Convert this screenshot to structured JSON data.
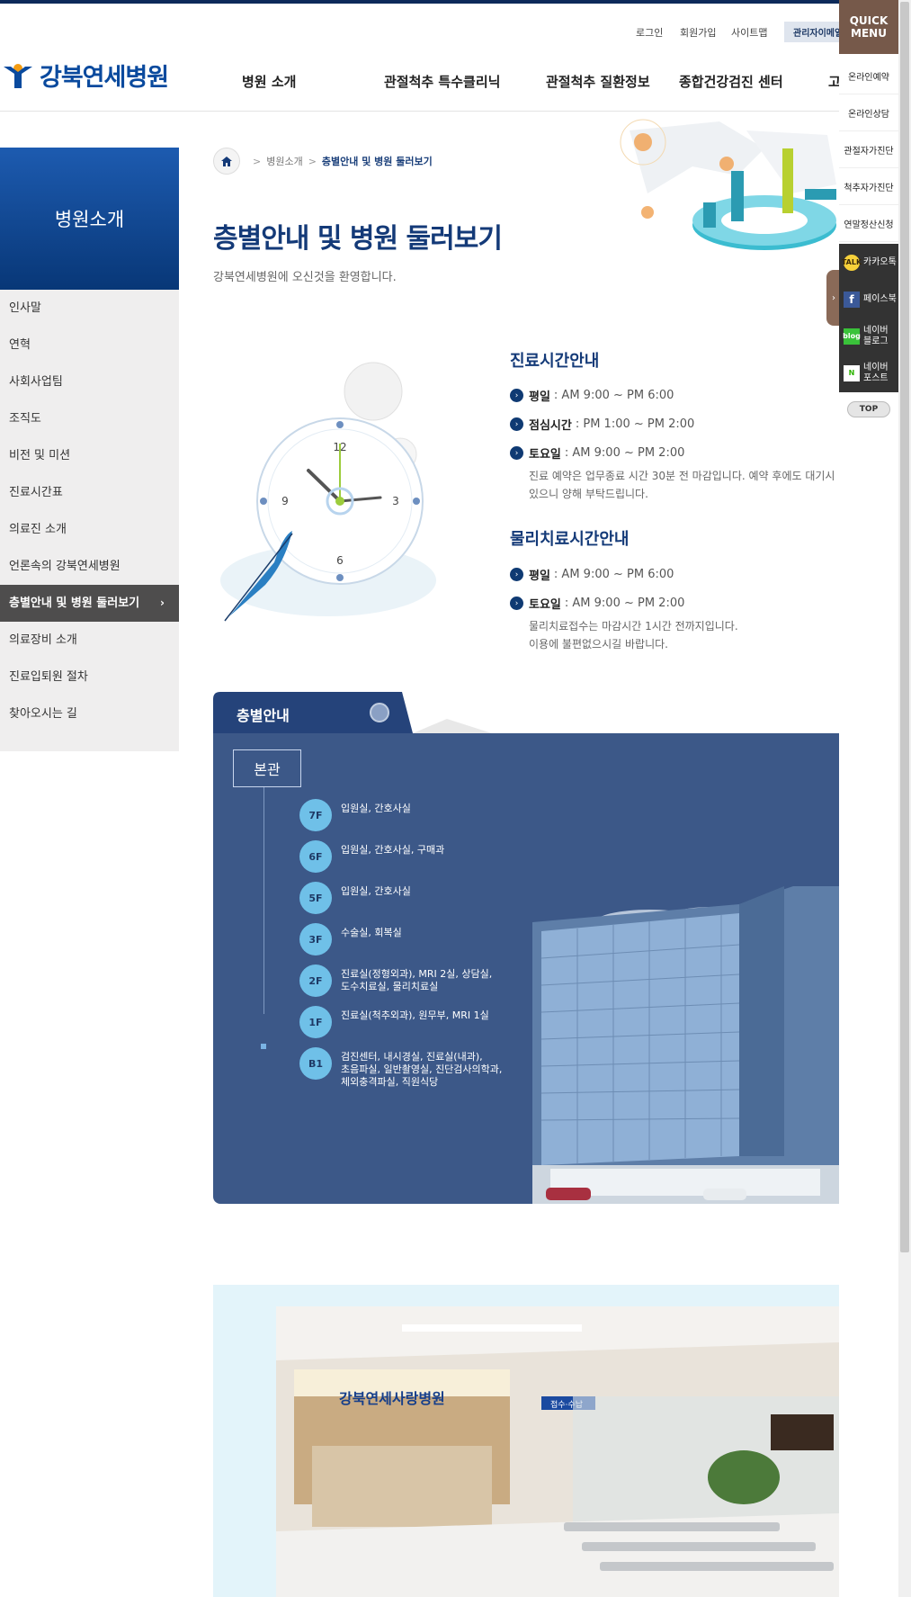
{
  "header": {
    "logo_text": "강북연세병원",
    "util_links": [
      "로그인",
      "회원가입",
      "사이트맵",
      "관리자이메일"
    ],
    "gnb": [
      "병원 소개",
      "관절척추 특수클리닉",
      "관절척추 질환정보",
      "종합건강검진 센터",
      "고"
    ]
  },
  "lnb": {
    "title": "병원소개",
    "items": [
      "인사말",
      "연혁",
      "사회사업팀",
      "조직도",
      "비전 및 미션",
      "진료시간표",
      "의료진 소개",
      "언론속의 강북연세병원",
      "층별안내 및 병원 둘러보기",
      "의료장비 소개",
      "진료입퇴원 절차",
      "찾아오시는 길"
    ],
    "active_index": 8
  },
  "breadcrumb": {
    "level1": "병원소개",
    "current": "층별안내 및 병원 둘러보기"
  },
  "page": {
    "title": "층별안내 및 병원 둘러보기",
    "subtitle": "강북연세병원에 오신것을 환영합니다."
  },
  "clock": {
    "n12": "12",
    "n3": "3",
    "n6": "6",
    "n9": "9"
  },
  "hours": {
    "title": "진료시간안내",
    "rows": [
      {
        "label": "평일",
        "value": ": AM 9:00 ~ PM 6:00"
      },
      {
        "label": "점심시간",
        "value": ": PM 1:00 ~ PM 2:00"
      },
      {
        "label": "토요일",
        "value": ": AM 9:00 ~ PM 2:00"
      }
    ],
    "note1": "진료 예약은 업무종료 시간 30분 전 마감입니다. 예약 후에도 대기시",
    "note2": "있으니 양해 부탁드립니다."
  },
  "pt_hours": {
    "title": "물리치료시간안내",
    "rows": [
      {
        "label": "평일",
        "value": ": AM 9:00 ~ PM 6:00"
      },
      {
        "label": "토요일",
        "value": ": AM 9:00 ~ PM 2:00"
      }
    ],
    "note1": "물리치료접수는 마감시간 1시간 전까지입니다.",
    "note2": "이용에 불편없으시길 바랍니다."
  },
  "floor_guide": {
    "tab": "층별안내",
    "building": "본관",
    "floors": [
      {
        "floor": "7F",
        "desc": "입원실, 간호사실"
      },
      {
        "floor": "6F",
        "desc": "입원실, 간호사실, 구매과"
      },
      {
        "floor": "5F",
        "desc": "입원실, 간호사실"
      },
      {
        "floor": "3F",
        "desc": "수술실, 회복실"
      },
      {
        "floor": "2F",
        "desc": "진료실(정형외과), MRI 2실, 상담실,\n도수치료실, 물리치료실"
      },
      {
        "floor": "1F",
        "desc": "진료실(척추외과), 원무부, MRI 1실"
      },
      {
        "floor": "B1",
        "desc": "검진센터, 내시경실, 진료실(내과),\n초음파실, 일반촬영실, 진단검사의학과,\n체외충격파실, 직원식당"
      }
    ]
  },
  "lobby": {
    "sign": "강북연세사랑병원",
    "desk_sign": "접수·수납"
  },
  "quick_menu": {
    "title": "QUICK MENU",
    "items": [
      "온라인예약",
      "온라인상담",
      "관절자가진단",
      "척추자가진단",
      "연말정산신청"
    ],
    "sns": [
      "카카오톡",
      "페이스북",
      "네이버 블로그",
      "네이버 포스트"
    ],
    "top": "TOP",
    "toggle": "›"
  },
  "colors": {
    "primary": "#143a78",
    "floor_panel": "#3c5888",
    "floor_circle": "#6fc0e8",
    "quick_head": "#76594a"
  }
}
